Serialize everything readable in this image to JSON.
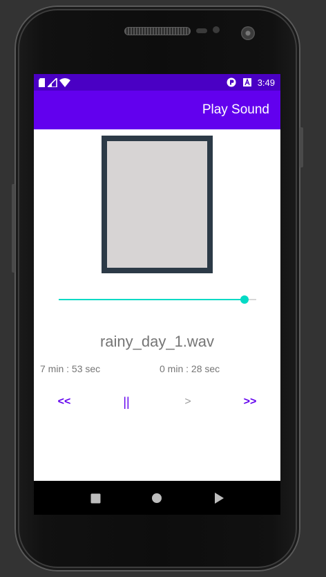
{
  "status_bar": {
    "time": "3:49",
    "icons": [
      "sd-card-icon",
      "signal-icon",
      "wifi-icon"
    ],
    "right_icons": [
      "play-protect-icon",
      "keyboard-a-icon"
    ]
  },
  "app_bar": {
    "title": "Play Sound"
  },
  "player": {
    "artwork_placeholder": "",
    "progress_fraction": 0.94,
    "track_name": "rainy_day_1.wav",
    "time_total": "7 min : 53 sec",
    "time_current": "0 min : 28 sec",
    "controls": {
      "rewind_label": "<<",
      "pause_label": "||",
      "play_label": ">",
      "forward_label": ">>"
    }
  },
  "nav_bar": {
    "buttons": [
      "recents-icon",
      "home-icon",
      "back-icon"
    ]
  },
  "colors": {
    "status_bar": "#4a00c4",
    "primary": "#6200ee",
    "accent": "#03dac5",
    "artwork_border": "#2c3a47",
    "artwork_fill": "#d7d4d4"
  }
}
